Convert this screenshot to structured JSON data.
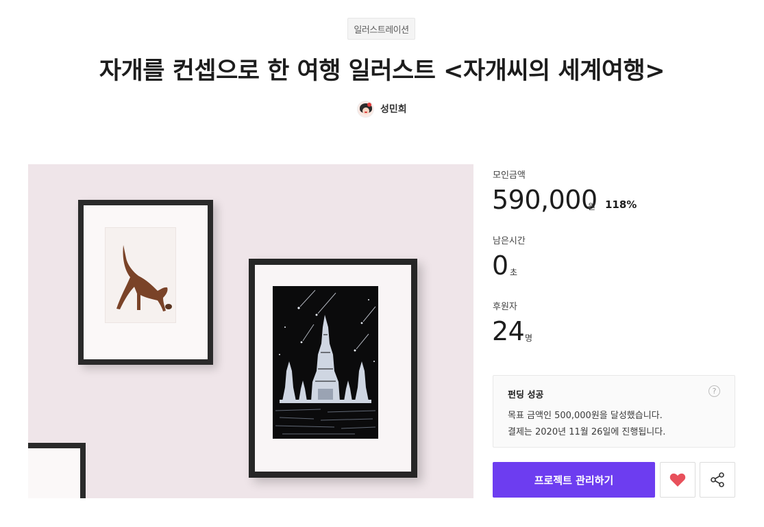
{
  "project": {
    "category": "일러스트레이션",
    "title": "자개를 컨셉으로 한 여행 일러스트 <자개씨의 세계여행>",
    "creator_name": "성민희"
  },
  "stats": {
    "raised_label": "모인금액",
    "raised_value": "590,000",
    "raised_unit": "원",
    "raised_percent": "118%",
    "time_label": "남은시간",
    "time_value": "0",
    "time_unit": "초",
    "backers_label": "후원자",
    "backers_value": "24",
    "backers_unit": "명"
  },
  "notice": {
    "title": "펀딩 성공",
    "line1": "목표 금액인 500,000원을 달성했습니다.",
    "line2": "결제는 2020년 11월 26일에 진행됩니다.",
    "help_glyph": "?"
  },
  "actions": {
    "manage_label": "프로젝트 관리하기",
    "like_icon": "heart-icon",
    "share_icon": "share-icon"
  },
  "colors": {
    "accent": "#6d3df0",
    "heart": "#e8505b"
  }
}
